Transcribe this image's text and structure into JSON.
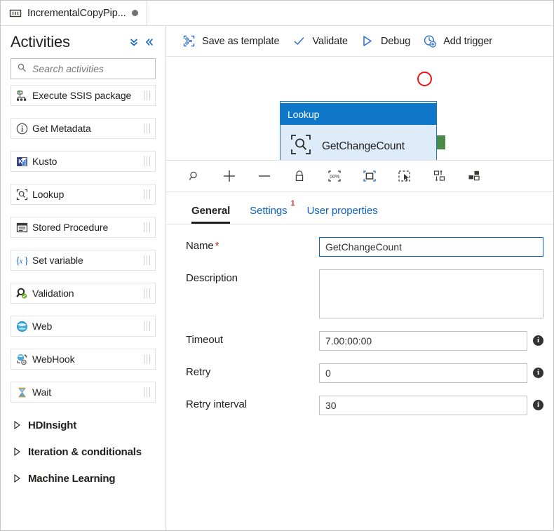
{
  "window": {
    "pipeline_tab": {
      "title": "IncrementalCopyPip...",
      "icon": "pipeline-icon",
      "dirty_indicator": "unsaved-dot"
    }
  },
  "sidebar": {
    "title": "Activities",
    "collapse_all_icon": "double-chevron-down-icon",
    "collapse_panel_icon": "double-chevron-left-icon",
    "search": {
      "placeholder": "Search activities",
      "value": "",
      "icon": "search-icon"
    },
    "items": [
      {
        "label": "Execute SSIS package",
        "icon": "ssis-package-icon"
      },
      {
        "label": "Get Metadata",
        "icon": "info-circle-icon"
      },
      {
        "label": "Kusto",
        "icon": "kusto-icon"
      },
      {
        "label": "Lookup",
        "icon": "lookup-icon"
      },
      {
        "label": "Stored Procedure",
        "icon": "stored-procedure-icon"
      },
      {
        "label": "Set variable",
        "icon": "set-variable-icon"
      },
      {
        "label": "Validation",
        "icon": "validation-icon"
      },
      {
        "label": "Web",
        "icon": "web-globe-icon"
      },
      {
        "label": "WebHook",
        "icon": "webhook-icon"
      },
      {
        "label": "Wait",
        "icon": "hourglass-icon"
      }
    ],
    "groups": [
      {
        "label": "HDInsight",
        "icon": "chevron-right-icon"
      },
      {
        "label": "Iteration & conditionals",
        "icon": "chevron-right-icon"
      },
      {
        "label": "Machine Learning",
        "icon": "chevron-right-icon"
      }
    ]
  },
  "toolbar": {
    "buttons": [
      {
        "label": "Save as template",
        "icon": "save-template-icon"
      },
      {
        "label": "Validate",
        "icon": "checkmark-icon"
      },
      {
        "label": "Debug",
        "icon": "play-triangle-icon"
      },
      {
        "label": "Add trigger",
        "icon": "add-trigger-icon"
      }
    ]
  },
  "canvas": {
    "node": {
      "type_label": "Lookup",
      "name": "GetChangeCount",
      "type_icon": "lookup-icon",
      "actions": [
        {
          "name": "delete-activity",
          "icon": "trash-icon"
        },
        {
          "name": "view-code",
          "icon": "code-brackets-icon"
        },
        {
          "name": "clone-activity",
          "icon": "copy-icon"
        },
        {
          "name": "add-output-dependency",
          "icon": "add-arrow-icon"
        }
      ],
      "status_marker": "red-circle-annotation",
      "output_connector": "green-success-connector"
    },
    "colors": {
      "node_header": "#0f77ca",
      "node_body": "#deecf9",
      "node_border": "#1e7cb0",
      "annotation_red": "#f01414",
      "connector_green": "#4a8b4a",
      "accent_blue": "#0b63ce"
    }
  },
  "zoom_toolbar": {
    "tools": [
      {
        "name": "zoom-to-fit-search",
        "icon": "magnifier-icon"
      },
      {
        "name": "zoom-in",
        "icon": "plus-icon"
      },
      {
        "name": "zoom-out",
        "icon": "minus-icon"
      },
      {
        "name": "lock-canvas",
        "icon": "lock-icon"
      },
      {
        "name": "zoom-100-percent",
        "icon": "zoom-100-icon",
        "label": "100%"
      },
      {
        "name": "zoom-to-fit",
        "icon": "fit-to-screen-icon"
      },
      {
        "name": "select-mode",
        "icon": "marquee-select-icon"
      },
      {
        "name": "auto-align-vertical",
        "icon": "align-vertical-icon"
      },
      {
        "name": "auto-align-horizontal",
        "icon": "align-horizontal-icon"
      }
    ]
  },
  "properties": {
    "tabs": [
      {
        "label": "General",
        "active": true,
        "badge": ""
      },
      {
        "label": "Settings",
        "active": false,
        "badge": "1"
      },
      {
        "label": "User properties",
        "active": false,
        "badge": ""
      }
    ],
    "fields": {
      "name": {
        "label": "Name",
        "required_mark": "*",
        "value": "GetChangeCount",
        "placeholder": ""
      },
      "description": {
        "label": "Description",
        "value": "",
        "placeholder": ""
      },
      "timeout": {
        "label": "Timeout",
        "value": "7.00:00:00",
        "info": "i"
      },
      "retry": {
        "label": "Retry",
        "value": "0",
        "info": "i"
      },
      "retry_interval": {
        "label": "Retry interval",
        "value": "30",
        "info": "i"
      }
    }
  }
}
